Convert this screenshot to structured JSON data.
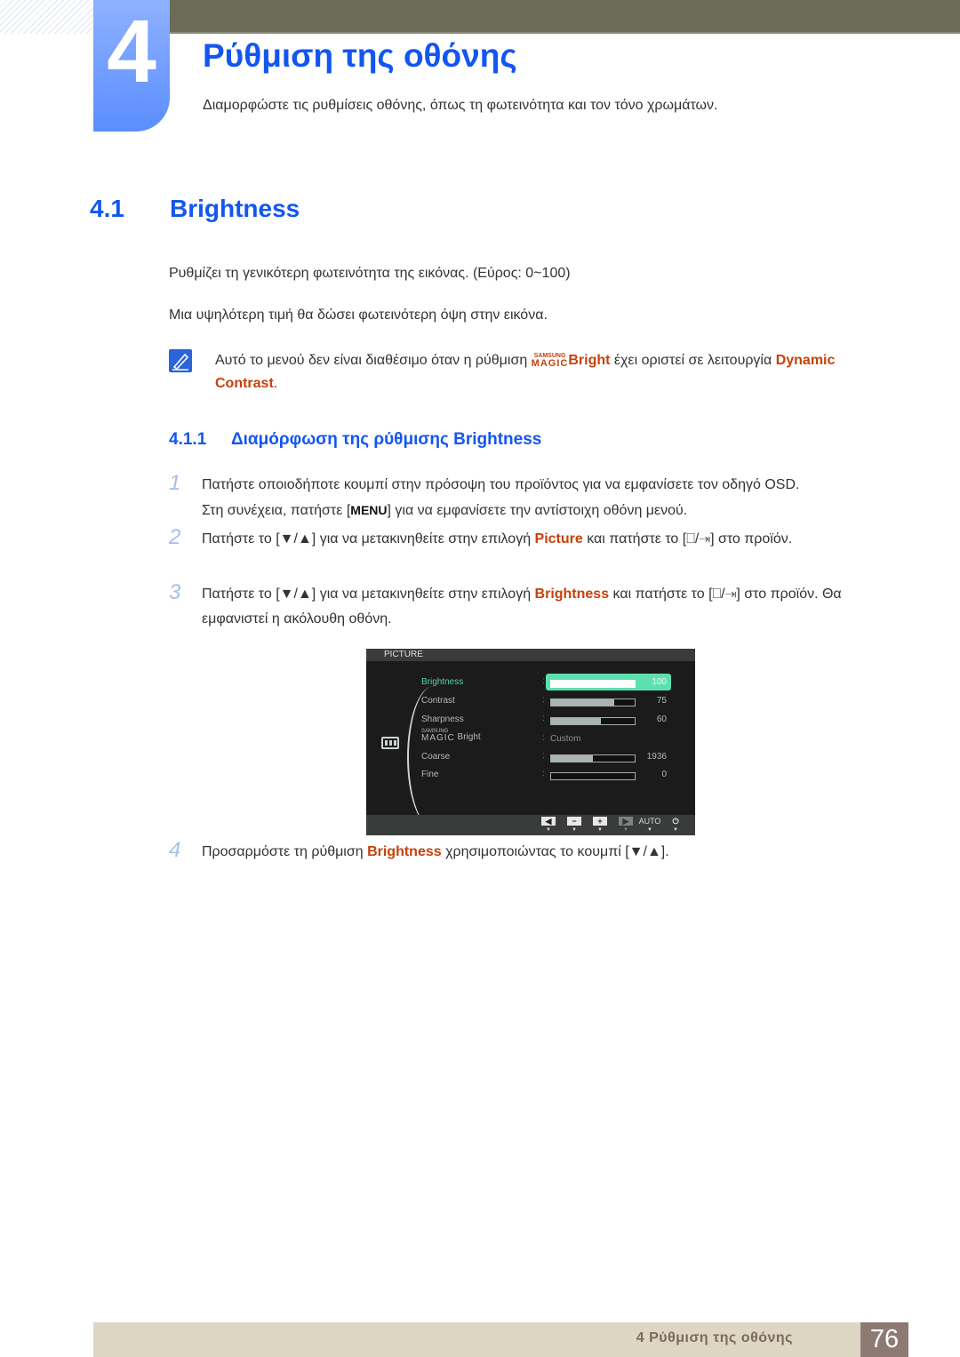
{
  "chapter": {
    "number": "4",
    "title": "Ρύθμιση της οθόνης",
    "subtitle": "Διαμορφώστε τις ρυθμίσεις οθόνης, όπως τη φωτεινότητα και τον τόνο χρωμάτων."
  },
  "section": {
    "number": "4.1",
    "title": "Brightness",
    "paragraphs": [
      "Ρυθμίζει τη γενικότερη φωτεινότητα της εικόνας. (Εύρος: 0~100)",
      "Μια υψηλότερη τιμή θα δώσει φωτεινότερη όψη στην εικόνα."
    ]
  },
  "note": {
    "icon": "note-pencil-icon",
    "text_before": "Αυτό το μενού δεν είναι διαθέσιμο όταν η ρύθμιση ",
    "magic_small": "SAMSUNG",
    "magic_big": "MAGIC",
    "highlight1": "Bright",
    "text_middle": " έχει οριστεί σε λειτουργία ",
    "highlight2": "Dynamic Contrast",
    "text_after": "."
  },
  "subsection": {
    "number": "4.1.1",
    "title": "Διαμόρφωση της ρύθμισης Brightness"
  },
  "steps": [
    {
      "num": "1",
      "line1": "Πατήστε οποιοδήποτε κουμπί στην πρόσοψη του προϊόντος για να εμφανίσετε τον οδηγό OSD.",
      "line2_before": "Στη συνέχεια, πατήστε [",
      "key": "MENU",
      "line2_after": "] για να εμφανίσετε την αντίστοιχη οθόνη μενού."
    },
    {
      "num": "2",
      "before": "Πατήστε το [▼/▲] για να μετακινηθείτε στην επιλογή ",
      "highlight": "Picture",
      "after": " και πατήστε το [⎕/⇥] στο προϊόν."
    },
    {
      "num": "3",
      "before": "Πατήστε το [▼/▲] για να μετακινηθείτε στην επιλογή ",
      "highlight": "Brightness",
      "after": " και πατήστε το [⎕/⇥] στο προϊόν. Θα εμφανιστεί η ακόλουθη οθόνη."
    },
    {
      "num": "4",
      "before": "Προσαρμόστε τη ρύθμιση ",
      "highlight": "Brightness",
      "after": " χρησιμοποιώντας το κουμπί [▼/▲]."
    }
  ],
  "osd": {
    "header": "PICTURE",
    "rows": [
      {
        "label": "Brightness",
        "value": "100",
        "percent": 100,
        "selected": true
      },
      {
        "label": "Contrast",
        "value": "75",
        "percent": 75
      },
      {
        "label": "Sharpness",
        "value": "60",
        "percent": 60
      },
      {
        "label_small": "SAMSUNG",
        "label_big": "MAGIC",
        "label_rest": " Bright",
        "text_value": "Custom"
      },
      {
        "label": "Coarse",
        "value": "1936",
        "percent": 50
      },
      {
        "label": "Fine",
        "value": "0",
        "percent": 0
      }
    ],
    "buttons": [
      {
        "icon": "left-arrow-icon",
        "glyph": "◀"
      },
      {
        "icon": "minus-icon",
        "glyph": "−"
      },
      {
        "icon": "plus-icon",
        "glyph": "+"
      },
      {
        "icon": "right-arrow-icon",
        "glyph": "▶"
      },
      {
        "icon": "auto-label",
        "glyph": "AUTO"
      },
      {
        "icon": "power-icon",
        "glyph": "⏻"
      }
    ]
  },
  "footer": {
    "chapter_label": "4 Ρύθμιση της οθόνης",
    "page_number": "76"
  },
  "colors": {
    "heading_blue": "#1356f0",
    "highlight_orange": "#c8400a",
    "osd_select_green": "#5de0b0"
  }
}
